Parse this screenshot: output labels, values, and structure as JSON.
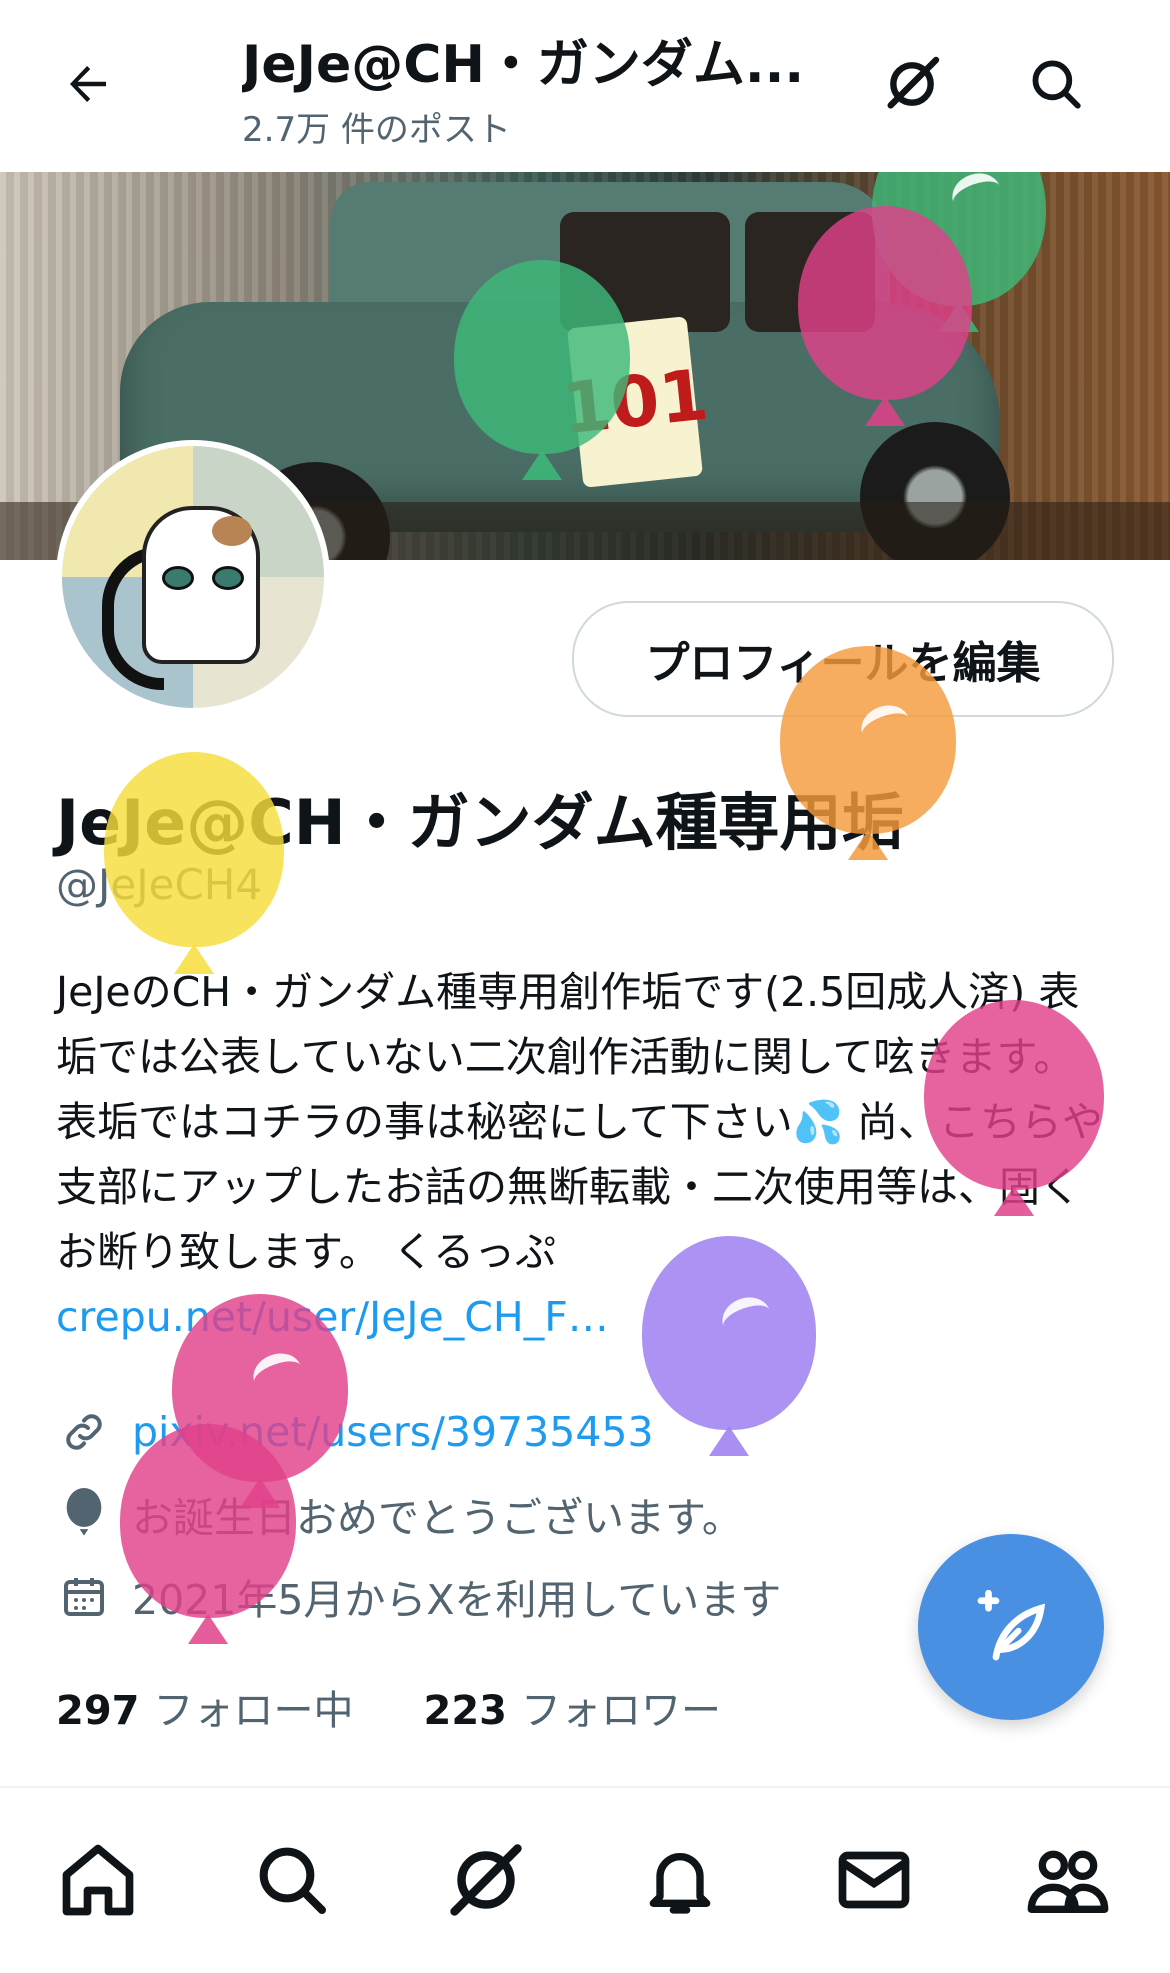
{
  "header": {
    "title": "JeJe@CH・ガンダム...",
    "post_count": "2.7万 件のポスト"
  },
  "banner": {
    "plate_text": "101"
  },
  "profile": {
    "edit_button": "プロフィールを編集",
    "display_name": "JeJe@CH・ガンダム種専用垢",
    "handle": "@JeJeCH4",
    "bio_text": "JeJeのCH・ガンダム種専用創作垢です(2.5回成人済) 表垢では公表していない二次創作活動に関して呟きます。 表垢ではコチラの事は秘密にして下さい💦 尚、こちらや支部にアップしたお話の無断転載・二次使用等は、固くお断り致します。 くるっぷ ",
    "bio_link": "crepu.net/user/JeJe_CH_F…",
    "website": "pixiv.net/users/39735453",
    "birthday": "お誕生日おめでとうございます。",
    "joined": "2021年5月からXを利用しています",
    "following_count": "297",
    "following_label": "フォロー中",
    "followers_count": "223",
    "followers_label": "フォロワー"
  },
  "icons": {
    "back": "arrow-left-icon",
    "grok": "grok-icon",
    "search": "search-icon",
    "link": "link-icon",
    "birthday": "balloon-icon",
    "calendar": "calendar-icon",
    "compose": "compose-icon",
    "home": "home-icon",
    "notifications": "bell-icon",
    "messages": "mail-icon",
    "communities": "communities-icon"
  },
  "colors": {
    "accent": "#1d9bf0",
    "fab": "#4a90e2",
    "balloons": [
      "#3dba7a",
      "#e0418a",
      "#f59b3c",
      "#f7dd3a",
      "#9a7bf0"
    ]
  }
}
